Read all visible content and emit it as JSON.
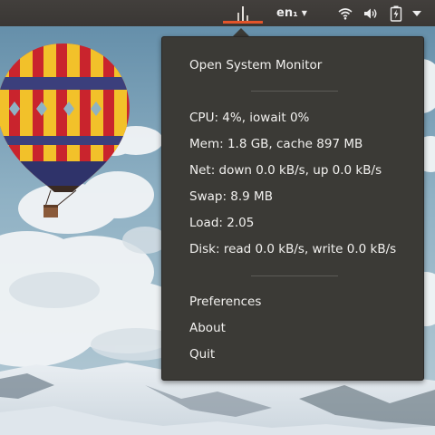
{
  "top_panel": {
    "keyboard_layout": "en₁",
    "dropdown_arrow": "▼",
    "icons": {
      "system_monitor": "system-monitor-graph-icon",
      "network": "wifi-icon",
      "sound": "speaker-volume-icon",
      "battery": "battery-charging-icon",
      "session": "chevron-down-icon"
    }
  },
  "menu": {
    "open_label": "Open System Monitor",
    "stats": {
      "cpu": "CPU: 4%, iowait 0%",
      "mem": "Mem: 1.8 GB, cache 897 MB",
      "net": "Net: down 0.0 kB/s, up 0.0 kB/s",
      "swap": "Swap: 8.9 MB",
      "load": "Load: 2.05",
      "disk": "Disk: read 0.0 kB/s, write 0.0 kB/s"
    },
    "preferences_label": "Preferences",
    "about_label": "About",
    "quit_label": "Quit"
  },
  "colors": {
    "panel_bg": "#3c3b37",
    "menu_bg": "#3b3a36",
    "menu_text": "#f2f1ef",
    "indicator_accent": "#e2542a"
  }
}
